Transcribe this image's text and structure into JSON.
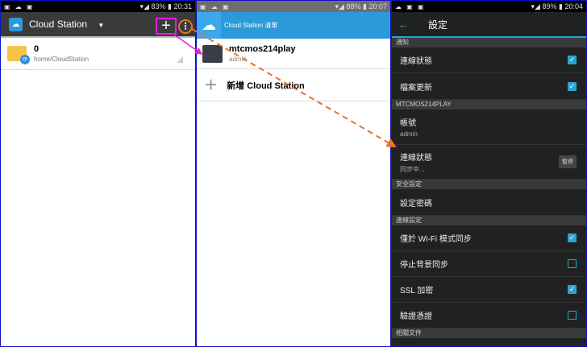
{
  "panel1": {
    "status": {
      "icons": "▣ ☁ ▣",
      "battery": "83%",
      "time": "20:31"
    },
    "title": "Cloud Station",
    "item": {
      "name": "0",
      "path": "home/CloudStation"
    }
  },
  "panel2": {
    "status": {
      "icons": "▣ ☁ ▣",
      "battery": "88%",
      "time": "20:07"
    },
    "header": "Cloud Station 清單",
    "server": {
      "name": "mtcmos214play",
      "user": "admin"
    },
    "add_label": "新增 Cloud Station"
  },
  "panel3": {
    "status": {
      "icons": "☁ ▣ ▣",
      "battery": "89%",
      "time": "20:04"
    },
    "title": "設定",
    "sections": {
      "notify": "通知",
      "server": "MTCMOS214PLAY",
      "security": "安全設定",
      "connection": "連線設定",
      "docs": "相關文件"
    },
    "rows": {
      "conn_status": "連線狀態",
      "file_update": "檔案更新",
      "account": "帳號",
      "account_value": "admin",
      "conn_status2": "連線狀態",
      "conn_status2_value": "同步中...",
      "pause": "暫停",
      "set_password": "設定密碼",
      "wifi_only": "僅於 Wi-Fi 模式同步",
      "stop_bg": "停止背景同步",
      "ssl": "SSL 加密",
      "verify_cert": "驗證憑證"
    },
    "checks": {
      "conn_status": true,
      "file_update": true,
      "wifi_only": true,
      "stop_bg": false,
      "ssl": true,
      "verify_cert": false
    }
  },
  "colors": {
    "accent": "#29a3d6",
    "magenta": "#e020e0",
    "orange": "#e8732a"
  }
}
